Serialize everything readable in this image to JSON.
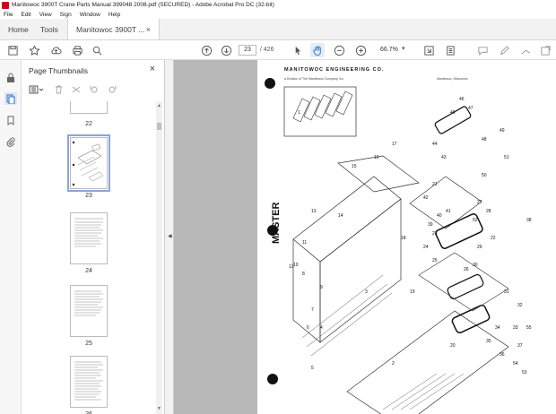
{
  "window": {
    "title": "Manitowoc 3900T Crane Parts Manual 399048 2008.pdf (SECURED) - Adobe Acrobat Pro DC (32-bit)"
  },
  "menu": [
    "File",
    "Edit",
    "View",
    "Sign",
    "Window",
    "Help"
  ],
  "tabs": {
    "home": "Home",
    "tools": "Tools",
    "doc": "Manitowoc 3900T ...",
    "close": "×"
  },
  "toolbar": {
    "page_current": "23",
    "page_total": "/ 426",
    "zoom": "66.7%",
    "zoom_dropdown": "▾"
  },
  "panel": {
    "title": "Page Thumbnails",
    "close": "×"
  },
  "thumbnails": [
    {
      "label": "22"
    },
    {
      "label": "23",
      "selected": true
    },
    {
      "label": "24"
    },
    {
      "label": "25"
    },
    {
      "label": "26"
    }
  ],
  "document": {
    "header": "MANITOWOC ENGINEERING CO.",
    "subheader": "a Division of The Manitowoc Company, Inc.",
    "right_header": "Manitowoc, Wisconsin",
    "side_text": "MASTER",
    "callouts": [
      "1",
      "2",
      "3",
      "4",
      "5",
      "6",
      "7",
      "8",
      "9",
      "10",
      "11",
      "12",
      "13",
      "14",
      "15",
      "16",
      "17",
      "18",
      "19",
      "20",
      "21",
      "22",
      "23",
      "24",
      "25",
      "26",
      "27",
      "28",
      "29",
      "30",
      "31",
      "32",
      "33",
      "34",
      "35",
      "36",
      "37",
      "38",
      "39",
      "40",
      "41",
      "42",
      "43",
      "44",
      "45",
      "46",
      "47",
      "48",
      "49",
      "50",
      "51",
      "52",
      "53",
      "54",
      "55"
    ]
  }
}
